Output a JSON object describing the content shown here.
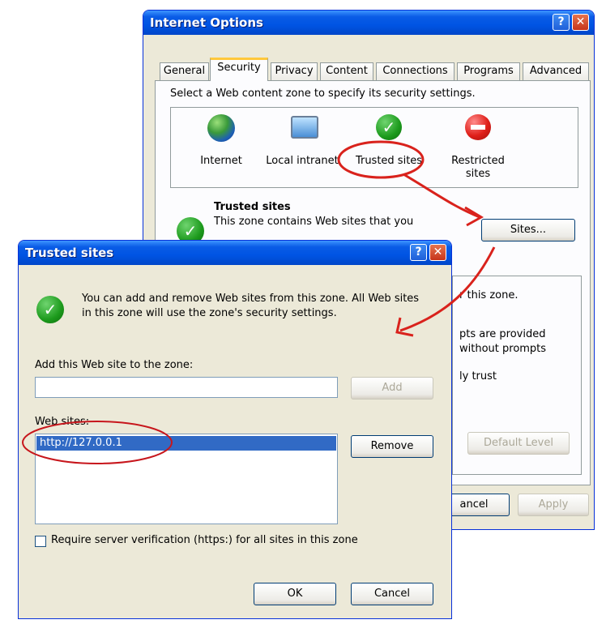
{
  "internet_options": {
    "title": "Internet Options",
    "help_glyph": "?",
    "close_glyph": "✕",
    "tabs": [
      {
        "label": "General"
      },
      {
        "label": "Security"
      },
      {
        "label": "Privacy"
      },
      {
        "label": "Content"
      },
      {
        "label": "Connections"
      },
      {
        "label": "Programs"
      },
      {
        "label": "Advanced"
      }
    ],
    "zone_prompt": "Select a Web content zone to specify its security settings.",
    "zones": [
      {
        "label": "Internet",
        "icon": "globe-icon"
      },
      {
        "label": "Local intranet",
        "icon": "intranet-computer-icon"
      },
      {
        "label": "Trusted sites",
        "icon": "checkmark-icon"
      },
      {
        "label": "Restricted sites",
        "icon": "restricted-icon"
      }
    ],
    "trusted_heading": "Trusted sites",
    "trusted_desc": "This zone contains Web sites that you",
    "sites_button": "Sites...",
    "partial_lines": [
      "r this zone.",
      "pts are provided",
      "without prompts",
      "ly trust"
    ],
    "default_level_button": "Default Level",
    "cancel_button_partial": "ancel",
    "apply_button": "Apply"
  },
  "trusted_sites": {
    "title": "Trusted sites",
    "help_glyph": "?",
    "close_glyph": "✕",
    "info_text_line1": "You can add and remove Web sites from this zone. All Web sites",
    "info_text_line2": "in this zone will use the zone's security settings.",
    "add_label": "Add this Web site to the zone:",
    "add_input_value": "",
    "add_button": "Add",
    "websites_label": "Web sites:",
    "websites": [
      "http://127.0.0.1"
    ],
    "remove_button": "Remove",
    "require_https_label": "Require server verification (https:) for all sites in this zone",
    "require_https_checked": false,
    "ok_button": "OK",
    "cancel_button": "Cancel"
  },
  "annotation_color": "#d9221c",
  "selection_color": "#316ac5"
}
